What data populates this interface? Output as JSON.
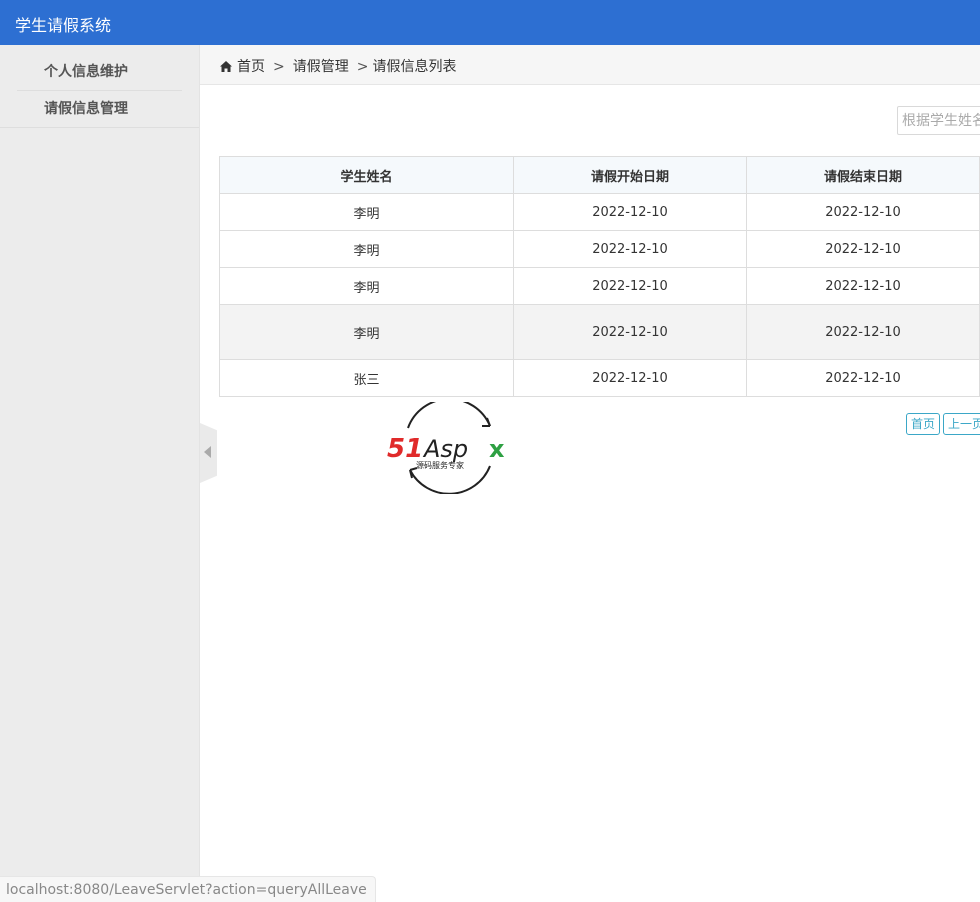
{
  "app": {
    "title": "学生请假系统"
  },
  "sidebar": {
    "items": [
      {
        "label": "个人信息维护"
      },
      {
        "label": "请假信息管理"
      }
    ]
  },
  "breadcrumb": {
    "home": "首页",
    "separator": ">",
    "level1": "请假管理",
    "level2": "请假信息列表"
  },
  "search": {
    "placeholder": "根据学生姓名"
  },
  "table": {
    "headers": [
      "学生姓名",
      "请假开始日期",
      "请假结束日期"
    ],
    "rows": [
      [
        "李明",
        "2022-12-10",
        "2022-12-10"
      ],
      [
        "李明",
        "2022-12-10",
        "2022-12-10"
      ],
      [
        "李明",
        "2022-12-10",
        "2022-12-10"
      ],
      [
        "李明",
        "2022-12-10",
        "2022-12-10"
      ],
      [
        "张三",
        "2022-12-10",
        "2022-12-10"
      ]
    ]
  },
  "pager": {
    "first": "首页",
    "prev": "上一页"
  },
  "watermark": {
    "brand": "51Aspx",
    "tagline": "源码服务专家"
  },
  "status": {
    "url": "localhost:8080/LeaveServlet?action=queryAllLeave"
  },
  "colors": {
    "header_bg": "#2d6fd2",
    "sidebar_bg": "#ececec",
    "pager_accent": "#3ba7c7"
  },
  "icons": {
    "home": "home-icon",
    "collapse": "chevron-left-icon"
  }
}
